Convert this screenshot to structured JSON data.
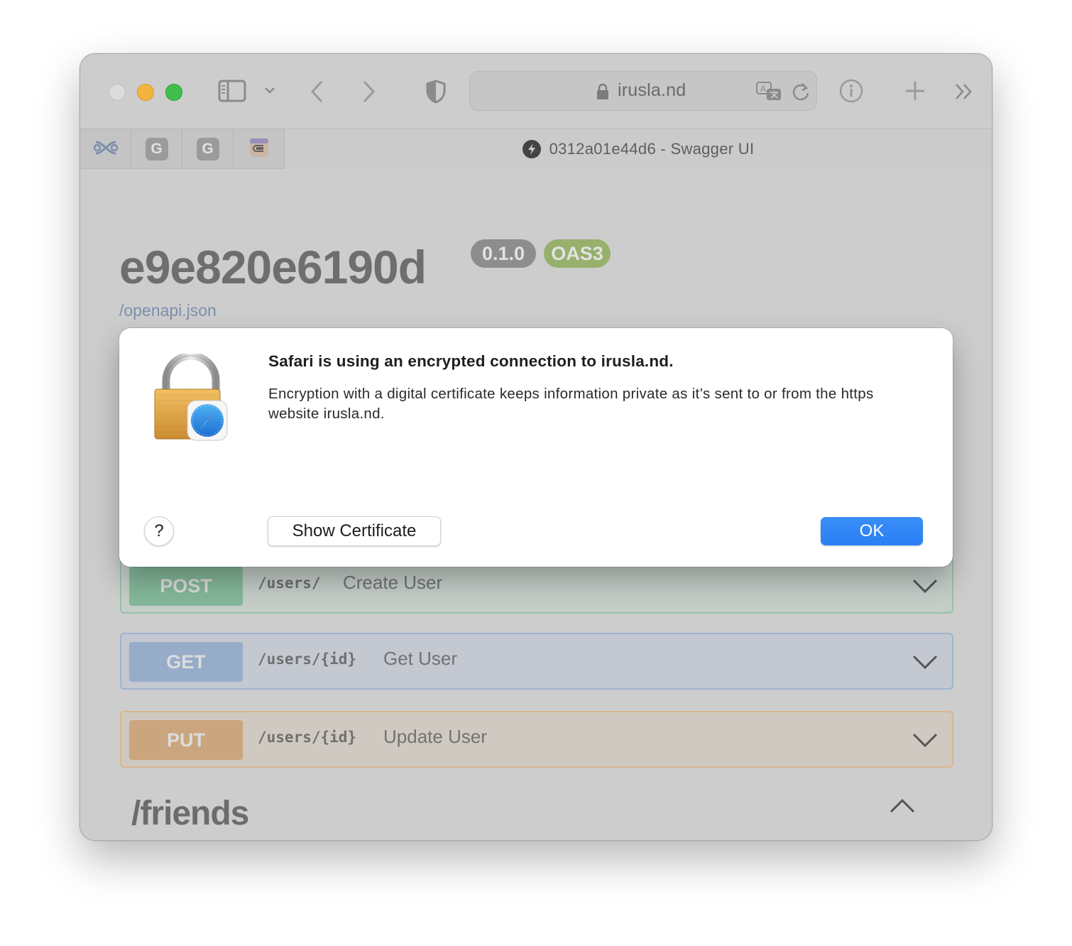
{
  "browser": {
    "url": "irusla.nd",
    "tabs": {
      "pinned": [
        {
          "icon": "link-logo-icon"
        },
        {
          "icon": "google-icon",
          "letter": "G"
        },
        {
          "icon": "google-icon",
          "letter": "G"
        },
        {
          "icon": "notes-app-icon"
        }
      ],
      "active_title": "0312a01e44d6 - Swagger UI"
    }
  },
  "page": {
    "api_title": "e9e820e6190d",
    "version_badge": "0.1.0",
    "spec_badge": "OAS3",
    "spec_link": "/openapi.json",
    "operations": [
      {
        "method": "POST",
        "path": "/users/",
        "summary": "Create User"
      },
      {
        "method": "GET",
        "path": "/users/{id}",
        "summary": "Get User"
      },
      {
        "method": "PUT",
        "path": "/users/{id}",
        "summary": "Update User"
      }
    ],
    "section": "/friends"
  },
  "dialog": {
    "title": "Safari is using an encrypted connection to irusla.nd.",
    "body": "Encryption with a digital certificate keeps information private as it’s sent to or from the https website irusla.nd.",
    "help_label": "?",
    "show_certificate_label": "Show Certificate",
    "ok_label": "OK"
  },
  "colors": {
    "ok_button": "#2a7ff3",
    "post": "#49cc90",
    "get": "#61affe",
    "put": "#fca130",
    "oas_badge": "#89bf04"
  }
}
